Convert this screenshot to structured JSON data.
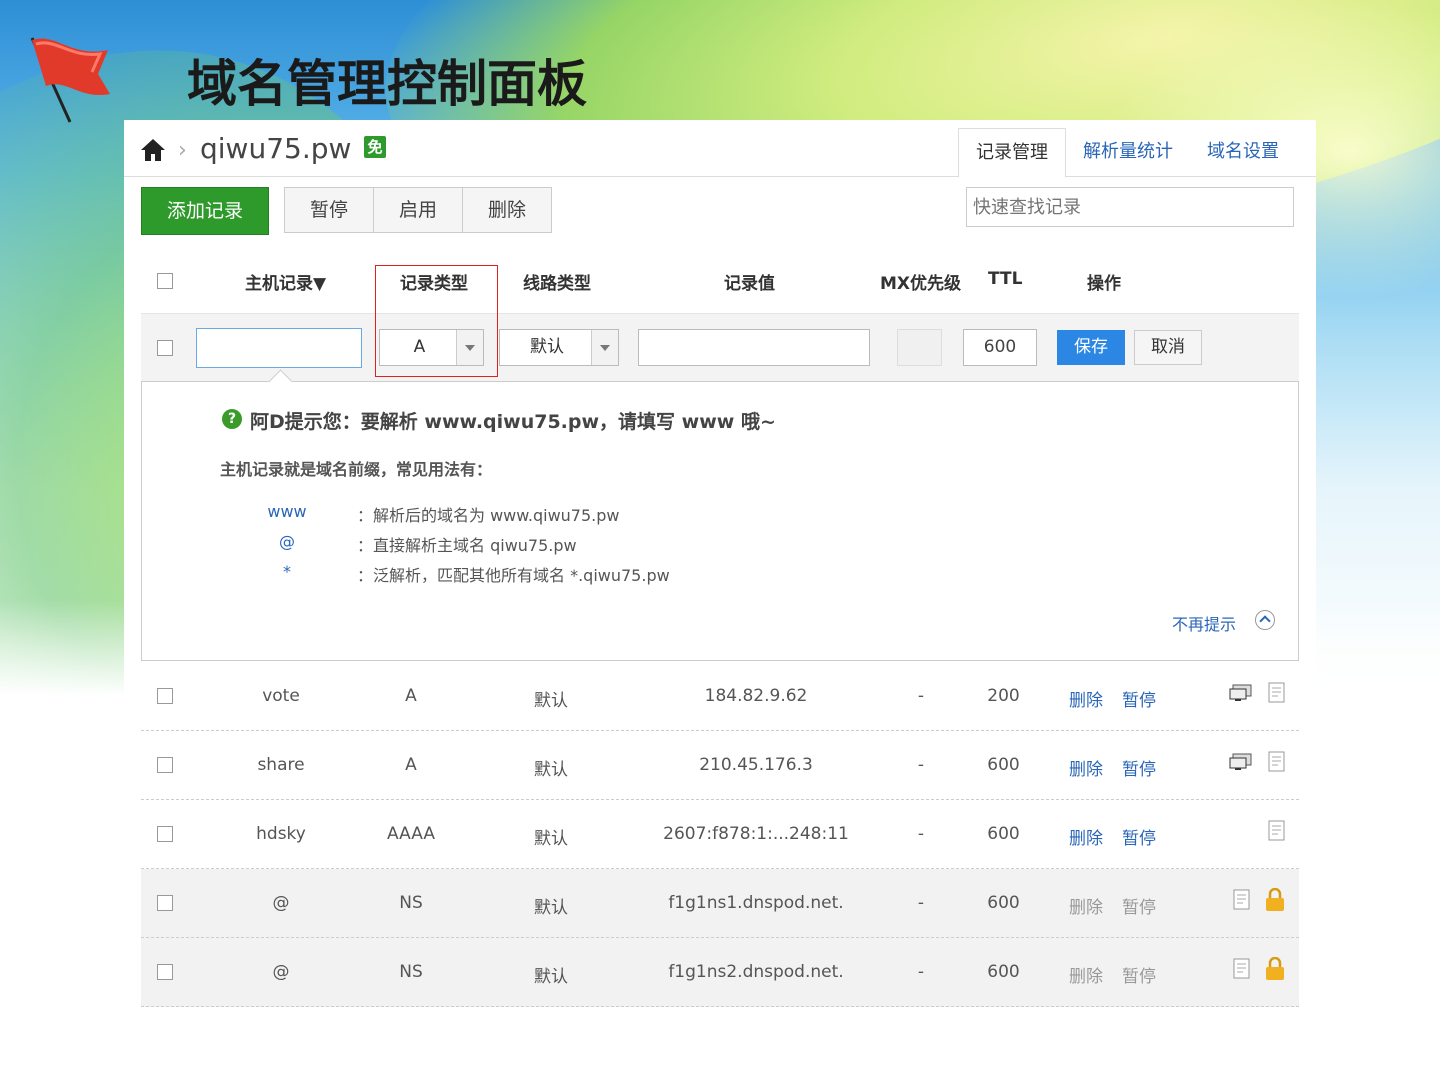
{
  "slide": {
    "title": "域名管理控制面板"
  },
  "header": {
    "separator": "›",
    "domain": "qiwu75.pw",
    "badge": "免",
    "tabs": [
      {
        "label": "记录管理",
        "active": true
      },
      {
        "label": "解析量统计",
        "active": false
      },
      {
        "label": "域名设置",
        "active": false
      }
    ]
  },
  "toolbar": {
    "add_label": "添加记录",
    "pause_label": "暂停",
    "enable_label": "启用",
    "delete_label": "删除",
    "search_placeholder": "快速查找记录"
  },
  "columns": {
    "host": "主机记录▼",
    "type": "记录类型",
    "line": "线路类型",
    "value": "记录值",
    "mx": "MX优先级",
    "ttl": "TTL",
    "ops": "操作"
  },
  "edit_row": {
    "host_value": "",
    "type_value": "A",
    "line_value": "默认",
    "record_value": "",
    "mx_value": "",
    "ttl_value": "600",
    "save_label": "保存",
    "cancel_label": "取消"
  },
  "tip": {
    "headline": "阿D提示您：要解析 www.qiwu75.pw，请填写 www 哦~",
    "intro": "主机记录就是域名前缀，常见用法有：",
    "examples": [
      {
        "key": "www",
        "desc": "：解析后的域名为 www.qiwu75.pw"
      },
      {
        "key": "@",
        "desc": "：直接解析主域名 qiwu75.pw"
      },
      {
        "key": "*",
        "desc": "：泛解析，匹配其他所有域名 *.qiwu75.pw"
      }
    ],
    "dismiss_label": "不再提示"
  },
  "records": [
    {
      "host": "vote",
      "type": "A",
      "line": "默认",
      "value": "184.82.9.62",
      "mx": "-",
      "ttl": "200",
      "del": "删除",
      "pause": "暂停",
      "disabled": false,
      "icons": [
        "monitor-icon",
        "note-icon"
      ]
    },
    {
      "host": "share",
      "type": "A",
      "line": "默认",
      "value": "210.45.176.3",
      "mx": "-",
      "ttl": "600",
      "del": "删除",
      "pause": "暂停",
      "disabled": false,
      "icons": [
        "monitor-icon",
        "note-icon"
      ]
    },
    {
      "host": "hdsky",
      "type": "AAAA",
      "line": "默认",
      "value": "2607:f878:1:...248:11",
      "mx": "-",
      "ttl": "600",
      "del": "删除",
      "pause": "暂停",
      "disabled": false,
      "icons": [
        "note-icon"
      ]
    },
    {
      "host": "@",
      "type": "NS",
      "line": "默认",
      "value": "f1g1ns1.dnspod.net.",
      "mx": "-",
      "ttl": "600",
      "del": "删除",
      "pause": "暂停",
      "disabled": true,
      "icons": [
        "note-icon",
        "lock-icon"
      ]
    },
    {
      "host": "@",
      "type": "NS",
      "line": "默认",
      "value": "f1g1ns2.dnspod.net.",
      "mx": "-",
      "ttl": "600",
      "del": "删除",
      "pause": "暂停",
      "disabled": true,
      "icons": [
        "note-icon",
        "lock-icon"
      ]
    }
  ],
  "colors": {
    "primary_green": "#2f9a2c",
    "save_blue": "#2b87e3",
    "link_blue": "#2a66b8",
    "highlight_red": "#dd2222",
    "lock_orange": "#f0b020"
  }
}
